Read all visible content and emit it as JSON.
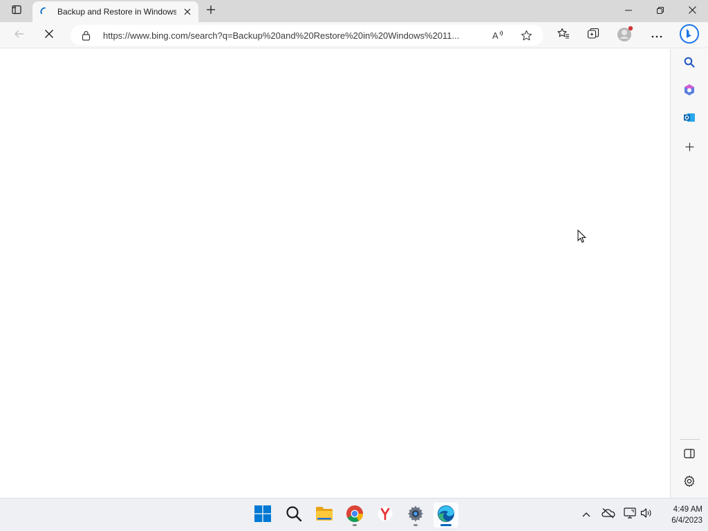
{
  "browser": {
    "tab": {
      "title": "Backup and Restore in Windows"
    },
    "address_bar": {
      "url": "https://www.bing.com/search?q=Backup%20and%20Restore%20in%20Windows%2011..."
    },
    "state": "loading"
  },
  "icons": {
    "titlebar": [
      "tab-actions-icon",
      "loading-spinner-icon",
      "close-tab-icon",
      "new-tab-icon",
      "minimize-icon",
      "restore-icon",
      "close-window-icon"
    ],
    "toolbar": [
      "back-icon",
      "stop-loading-icon",
      "lock-icon",
      "read-aloud-icon",
      "favorite-star-icon",
      "favorites-icon",
      "collections-icon",
      "profile-icon",
      "more-icon",
      "bing-copilot-icon"
    ],
    "sidebar": [
      "search-icon",
      "office-icon",
      "outlook-icon",
      "add-icon",
      "hide-sidebar-icon",
      "settings-icon"
    ],
    "taskbar": [
      "windows-start-icon",
      "search-icon",
      "file-explorer-icon",
      "chrome-icon",
      "yandex-icon",
      "settings-icon",
      "edge-icon"
    ],
    "tray": [
      "chevron-up-icon",
      "onedrive-icon",
      "network-icon",
      "volume-icon"
    ]
  },
  "taskbar": {
    "clock": {
      "time": "4:49 AM",
      "date": "6/4/2023"
    }
  },
  "colors": {
    "accent": "#0067c0",
    "tabstrip": "#d9d9d9",
    "toolbar": "#f7f7f7",
    "taskbar": "#eef0f4"
  }
}
